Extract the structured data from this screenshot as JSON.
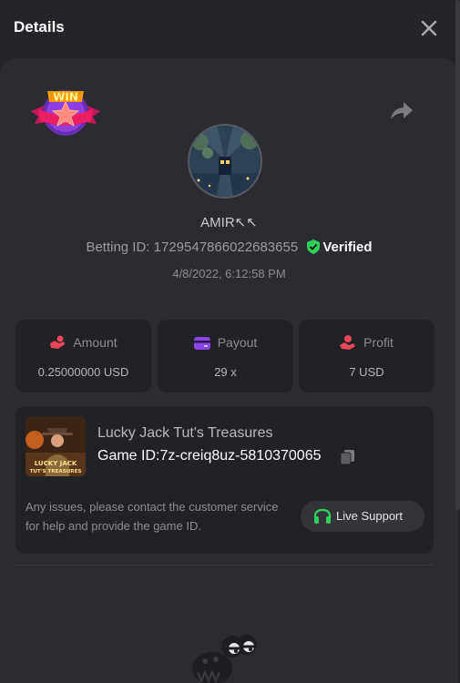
{
  "header": {
    "title": "Details"
  },
  "bet": {
    "username": "AMIR↖↖",
    "betting_id_label": "Betting ID:",
    "betting_id": "1729547866022683655",
    "verified_label": "Verified",
    "datetime": "4/8/2022, 6:12:58 PM"
  },
  "stats": [
    {
      "label": "Amount",
      "value": "0.25000000 USD",
      "icon": "hand-coins-icon",
      "color": "#e8475a"
    },
    {
      "label": "Payout",
      "value": "29 x",
      "icon": "wallet-card-icon",
      "color": "#8b45e6"
    },
    {
      "label": "Profit",
      "value": "7 USD",
      "icon": "profit-hand-icon",
      "color": "#e8475a"
    }
  ],
  "game": {
    "name": "Lucky Jack Tut's Treasures",
    "id_label": "Game ID:",
    "id": "7z-creiq8uz-5810370065",
    "thumb_text": "LUCKY JACK TUT'S TREASURES",
    "issue_text": "Any issues, please contact the customer service for help and provide the game ID.",
    "support_label": "Live Support"
  },
  "colors": {
    "accent_green": "#2fd05a",
    "background": "#24252a",
    "panel": "#2b2c31",
    "card": "#212226"
  }
}
